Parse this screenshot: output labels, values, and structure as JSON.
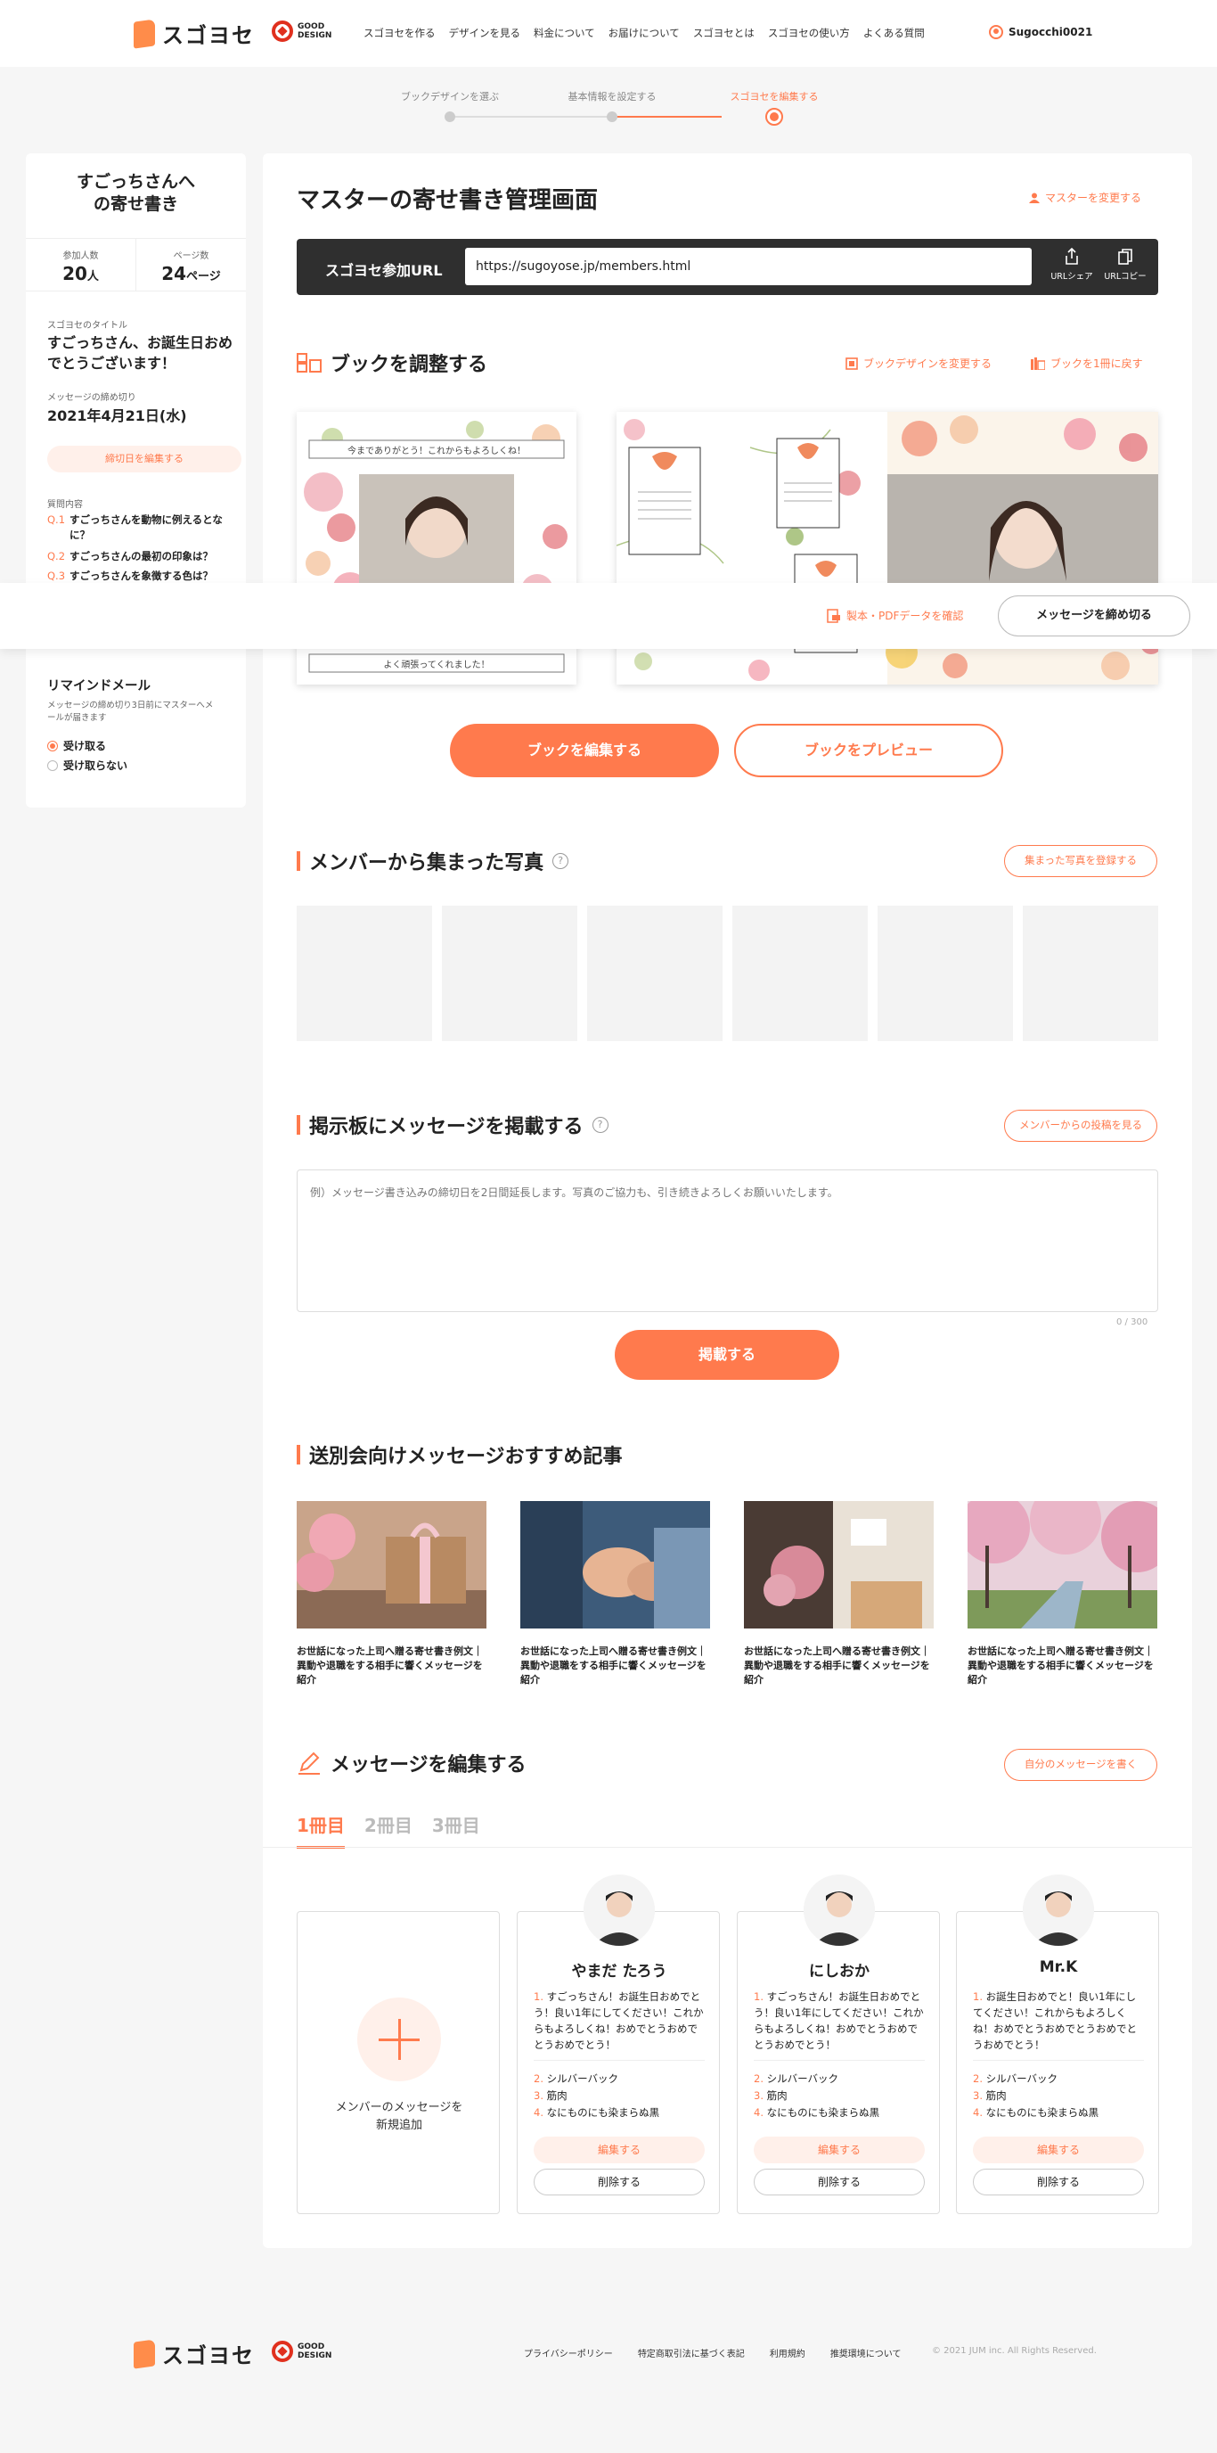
{
  "header": {
    "logo_text": "スゴヨセ",
    "gd_line1": "GOOD",
    "gd_line2": "DESIGN",
    "nav": [
      "スゴヨセを作る",
      "デザインを見る",
      "料金について",
      "お届けについて",
      "スゴヨセとは",
      "スゴヨセの使い方",
      "よくある質問"
    ],
    "username": "Sugocchi0021"
  },
  "steps": [
    {
      "label": "ブックデザインを選ぶ"
    },
    {
      "label": "基本情報を設定する"
    },
    {
      "label": "スゴヨセを編集する"
    }
  ],
  "sidebar": {
    "title_line1": "すごっちさんへ",
    "title_line2": "の寄せ書き",
    "members_label": "参加人数",
    "members_value": "20",
    "members_unit": "人",
    "pages_label": "ページ数",
    "pages_value": "24",
    "pages_unit": "ページ",
    "yosegaki_title_label": "スゴヨセのタイトル",
    "yosegaki_title": "すごっちさん、お誕生日おめでとうございます！",
    "deadline_label": "メッセージの締め切り",
    "deadline": "2021年4月21日(水)",
    "edit_deadline": "締切日を編集する",
    "questions_label": "質問内容",
    "questions": [
      {
        "no": "Q.1",
        "text": "すごっちさんを動物に例えるとなに？"
      },
      {
        "no": "Q.2",
        "text": "すごっちさんの最初の印象は？"
      },
      {
        "no": "Q.3",
        "text": "すごっちさんを象徴する色は？"
      }
    ],
    "remind_title": "リマインドメール",
    "remind_desc": "メッセージの締め切り3日前にマスターへメールが届きます",
    "remind_on": "受け取る",
    "remind_off": "受け取らない"
  },
  "main": {
    "title": "マスターの寄せ書き管理画面",
    "change_master": "マスターを変更する",
    "url_label": "スゴヨセ参加URL",
    "url_value": "https://sugoyose.jp/members.html",
    "url_share": "URLシェア",
    "url_copy": "URLコピー",
    "book_section_title": "ブックを調整する",
    "change_design": "ブックデザインを変更する",
    "back_to_one": "ブックを1冊に戻す",
    "book_header_text": "今までありがとう！これからもよろしくね！",
    "book_footer_text": "よく頑張ってくれました！",
    "edit_book": "ブックを編集する",
    "preview_book": "ブックをプレビュー",
    "photos_title": "メンバーから集まった写真",
    "register_photos": "集まった写真を登録する",
    "board_title": "掲示板にメッセージを掲載する",
    "view_member_posts": "メンバーからの投稿を見る",
    "board_placeholder": "例）メッセージ書き込みの締切日を2日間延長します。写真のご協力も、引き続きよろしくお願いいたします。",
    "board_counter": "0 / 300",
    "post_button": "掲載する",
    "articles_title": "送別会向けメッセージおすすめ記事",
    "articles": [
      {
        "caption": "お世話になった上司へ贈る寄せ書き例文｜異動や退職をする相手に響くメッセージを紹介"
      },
      {
        "caption": "お世話になった上司へ贈る寄せ書き例文｜異動や退職をする相手に響くメッセージを紹介"
      },
      {
        "caption": "お世話になった上司へ贈る寄せ書き例文｜異動や退職をする相手に響くメッセージを紹介"
      },
      {
        "caption": "お世話になった上司へ贈る寄せ書き例文｜異動や退職をする相手に響くメッセージを紹介"
      }
    ],
    "edit_title": "メッセージを編集する",
    "write_own": "自分のメッセージを書く",
    "tabs": [
      "1冊目",
      "2冊目",
      "3冊目"
    ],
    "add_member_line1": "メンバーのメッセージを",
    "add_member_line2": "新規追加",
    "members": [
      {
        "name": "やまだ たろう",
        "message": "すごっちさん！お誕生日おめでとう！良い1年にしてください！これからもよろしくね！おめでとうおめでとうおめでとう！",
        "a2": "シルバーバック",
        "a3": "筋肉",
        "a4": "なにものにも染まらぬ黒"
      },
      {
        "name": "にしおか",
        "message": "すごっちさん！お誕生日おめでとう！良い1年にしてください！これからもよろしくね！おめでとうおめでとうおめでとう！",
        "a2": "シルバーバック",
        "a3": "筋肉",
        "a4": "なにものにも染まらぬ黒"
      },
      {
        "name": "Mr.K",
        "message": "お誕生日おめでと！良い1年にしてください！これからもよろしくね！おめでとうおめでとうおめでとうおめでとう！",
        "a2": "シルバーバック",
        "a3": "筋肉",
        "a4": "なにものにも染まらぬ黒"
      }
    ],
    "n1": "1.",
    "n2": "2.",
    "n3": "3.",
    "n4": "4.",
    "edit_btn": "編集する",
    "delete_btn": "削除する"
  },
  "floatbar": {
    "pdf_link": "製本・PDFデータを確認",
    "close_messages": "メッセージを締め切る"
  },
  "footer": {
    "links": [
      "プライバシーポリシー",
      "特定商取引法に基づく表記",
      "利用規約",
      "推奨環境について"
    ],
    "copyright": "© 2021 JUM inc. All Rights Reserved."
  },
  "colors": {
    "accent": "#ff7a4d",
    "dark_bar": "#2f2f2f",
    "page_bg": "#f6f6f6"
  }
}
